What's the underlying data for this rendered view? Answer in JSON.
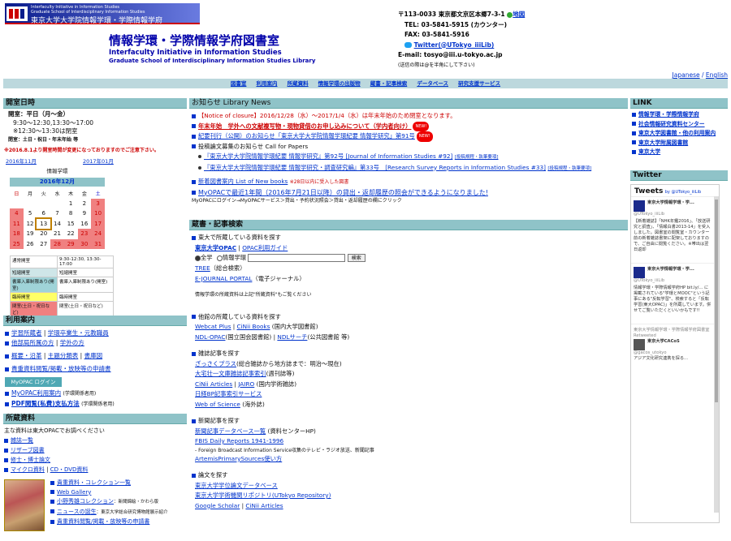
{
  "header": {
    "logo_line1": "Interfaculty Initiative in Information Studies",
    "logo_line2": "Graduate School of Interdisciplinary Information Studies",
    "logo_line3": "The University of Tokyo",
    "logo_big": "東京大学大学院情報学環・学際情報学府",
    "title": "情報学環・学際情報学府図書室",
    "sub1": "Interfaculty Initiative in Information Studies",
    "sub2": "Graduate School of Interdisciplinary Information Studies Library",
    "address": "〒113-0033 東京都文京区本郷7-3-1",
    "map_link": "地図",
    "tel": "TEL: 03-5841-5915 (カウンター)",
    "fax": "FAX: 03-5841-5916",
    "twitter": "Twitter(@UTokyo_iiiLib)",
    "email": "E-mail: tosyo@iii.u-tokyo.ac.jp",
    "email_note": "(送信の際は@を半角にして下さい)",
    "lang_ja": "Japanese",
    "lang_en": "English"
  },
  "nav": [
    "図書室",
    "利用案内",
    "所蔵資料",
    "情報学環の出版物",
    "蔵書・記事検索",
    "データベース",
    "研究支援サービス"
  ],
  "left": {
    "hours_title": "開室日時",
    "hours_1": "開室：平日（月～金）",
    "hours_2": "9:30～12:30,13:30～17:00",
    "hours_3": "※12:30～13:30は閉室",
    "hours_4": "閉室：土日・祝日・年末年始 等",
    "hours_notice": "※2016.8.1より開室時間が変更になっておりますのでご注意下さい。",
    "cal_prev": "2016年11月",
    "cal_next": "2017年01月",
    "cal_org": "情報学環",
    "cal_month": "2016年12月",
    "cal_days": [
      "日",
      "月",
      "火",
      "水",
      "木",
      "金",
      "土"
    ],
    "cal_rows": [
      [
        "",
        "",
        "",
        "",
        "1",
        "2",
        "3"
      ],
      [
        "4",
        "5",
        "6",
        "7",
        "8",
        "9",
        "10"
      ],
      [
        "11",
        "12",
        "13",
        "14",
        "15",
        "16",
        "17"
      ],
      [
        "18",
        "19",
        "20",
        "21",
        "22",
        "23",
        "24"
      ],
      [
        "25",
        "26",
        "27",
        "28",
        "29",
        "30",
        "31"
      ]
    ],
    "legend": [
      [
        "通常開室",
        "9:30-12:30, 13:30-17:00"
      ],
      [
        "短縮開室",
        "短縮開室"
      ],
      [
        "書庫入庫制限あり(開室)",
        "書庫入庫制限あり(開室)"
      ],
      [
        "臨時開室",
        "臨時開室"
      ],
      [
        "閉室(土日・祝日など)",
        "閉室(土日・祝日など)"
      ]
    ],
    "usage_title": "利用案内",
    "usage_links": [
      [
        "学習所蔵者",
        "学環卒業生・元教職員"
      ],
      [
        "他部局所属の方",
        "学外の方"
      ],
      [
        "概要・沿革",
        "主題分類表",
        "書庫図"
      ],
      [
        "貴重資料閲覧/掲載・放映等の申請書"
      ]
    ],
    "myopac_btn": "MyOPAC ログイン",
    "myopac_links": [
      "MyOPAC利用案内",
      "PDF閲覧(私費)支払方法"
    ],
    "myopac_note1": "(学環関係者用)",
    "myopac_note2": "(学環関係者用)",
    "coll_title": "所蔵資料",
    "coll_intro": "主な資料は東大OPACでお調べください",
    "coll_links": [
      "雑誌一覧",
      "リザーブ図書",
      "修士・博士論文",
      "マイクロ資料",
      "CD・DVD資料"
    ],
    "coll_links2": [
      "貴重資料・コレクション一覧",
      "Web Gallery",
      "小野秀雄コレクション",
      "ニュースの誕生",
      "貴重資料閲覧/掲載・放映等の申請書"
    ],
    "coll_note1": "：新聞錦絵・かわら版",
    "coll_note2": "：東京大学総合研究博物館展示紹介"
  },
  "center": {
    "news_title": "お知らせ Library News",
    "news": [
      "【Notice of closure】2016/12/28（水）～2017/1/4（水）は年末年始のため閉室となります。",
      "年末年始　学外への文献複写物・現物貸借のお申し込みについて（学内者向け）",
      "紀要刊行（公開）のお知らせ「東京大学大学院情報学環紀要 情報学研究」第91号",
      "投稿論文募集のお知らせ Call for Papers",
      "『東京大学大学院情報学環紀要 情報学研究』第92号 [Journal of Information Studies #92]",
      "『東京大学大学院情報学環紀要 情報学研究・調査研究編』第33号　[Research Survey Reports in Information Studies #33]"
    ],
    "news_tag": "[投稿規程・執筆要項]",
    "new_badge": "NEW!",
    "newbooks": "新着図書案内 List of New books",
    "newbooks_note": "※28日以内に受入した図書",
    "myopac_notice": "MyOPACで最近1年間（2016年7月21日以降）の貸出・返却履歴の照会ができるようになりました!",
    "myopac_notice_sub": "MyOPACにログイン→MyOPACサービス＞貸出・予約状況照会＞貸出・返却履歴の欄にクリック",
    "search_title": "蔵書・記事検索",
    "s1_head": "東大で所蔵している資料を探す",
    "s1_links": [
      "東京大学OPAC",
      "OPAC利用ガイド"
    ],
    "s1_radio1": "全学",
    "s1_radio2": "情報学環",
    "s1_button": "検索",
    "s1_tree": "TREE",
    "s1_tree_note": "（総合検索）",
    "s1_ej": "E-JOURNAL PORTAL",
    "s1_ej_note": "（電子ジャーナル）",
    "s1_note": "情報学環の所蔵資料は上記\"所蔵資料\"もご覧ください",
    "s2_head": "他館の所蔵している資料を探す",
    "s2_a": "Webcat Plus",
    "s2_b": "CiNii Books",
    "s2_b_note": "(国内大学図書館)",
    "s2_c": "NDL-OPAC",
    "s2_c_note": "(国立国会図書館)",
    "s2_d": "NDLサーチ",
    "s2_d_note": "(公共図書館 等)",
    "s3_head": "雑誌記事を探す",
    "s3_a": "ざっさくプラス",
    "s3_a_note": "(総合雑誌から地方誌まで：明治～現在)",
    "s3_b": "大宅壮一文庫雑誌記事索引",
    "s3_b_note": "(週刊誌等)",
    "s3_c": "CiNii Articles",
    "s3_d": "JAIRO",
    "s3_d_note": "(国内学術雑誌)",
    "s3_e": "日経BP記事索引サービス",
    "s3_f": "Web of Science",
    "s3_f_note": "(海外誌)",
    "s4_head": "新聞記事を探す",
    "s4_a": "新聞記事データベース一覧",
    "s4_a_note": "(資料センターHP)",
    "s4_b": "FBIS Daily Reports 1941-1996",
    "s4_b_note": "- Foreign Broadcast Information Service収集のテレビ・ラジオ放送、新聞記事",
    "s4_c": "ArtemisPrimarySources使い方",
    "s5_head": "論文を探す",
    "s5_a": "東京大学学位論文データベース",
    "s5_b": "東京大学学術機関リポジトリ(UTokyo Repository)",
    "s5_c": "Google Scholar",
    "s5_d": "CiNii Articles"
  },
  "right": {
    "link_title": "LINK",
    "links": [
      "情報学環・学際情報学府",
      "社会情報研究資料センター",
      "東京大学図書館・他の利用案内",
      "東京大学附属図書館",
      "東京大学"
    ],
    "twitter_title": "Twitter",
    "tweets_head": "Tweets",
    "tweets_by": "by @UTokyo_iiiLib",
    "t_name": "東京大学情報学環・学...",
    "t_handle": "@UTokyo_iiiLib",
    "t1": "【新着雑誌】「NHK年鑑2016」、「放送研究と調査」、「情報白書2013-14」を受入しました。図書室の閲覧室・カウンター前の新着雑誌書架に配架しておりますので、ご自由に閲覧ください。※帯出は翌日返却",
    "t2": "情報学環・学際情報学府HP bit.ly/... に掲載されている\"学環とMOOC\"という記事にある\"反転学習\"、検索すると「反転学習(東大OPAC)」を所蔵しています。併せてご覧いただくといいかもです!!",
    "t3_retweet": "東京大学情報学環・学際情報学府図書室 Retweeted",
    "t3_name": "東京大学CACoS",
    "t3_handle": "@gacos_utokyo",
    "t3": "アジア文化研究連携を探る..."
  }
}
